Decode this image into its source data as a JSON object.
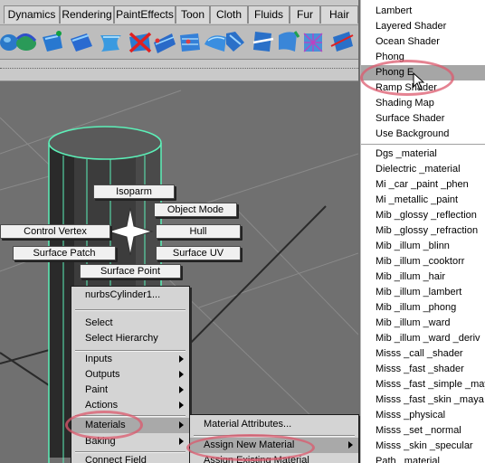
{
  "shelf_tabs": [
    "Dynamics",
    "Rendering",
    "PaintEffects",
    "Toon",
    "Cloth",
    "Fluids",
    "Fur",
    "Hair"
  ],
  "shelf_icons": [
    "sphere-shape-icon",
    "curve-tool-icon",
    "surface-icon",
    "surface-icon",
    "surface-icon",
    "delete-surface-icon",
    "surface-icon",
    "surface-icon",
    "surface-icon",
    "surface-icon",
    "surface-icon",
    "surface-icon",
    "surface-icon",
    "surface-icon"
  ],
  "marking_menu": {
    "isoparm": "Isoparm",
    "object_mode": "Object Mode",
    "control_vertex": "Control Vertex",
    "hull": "Hull",
    "surface_patch": "Surface Patch",
    "surface_uv": "Surface UV",
    "surface_point": "Surface Point"
  },
  "context_menu": {
    "object_name": "nurbsCylinder1...",
    "select": "Select",
    "select_hierarchy": "Select Hierarchy",
    "inputs": "Inputs",
    "outputs": "Outputs",
    "paint": "Paint",
    "actions": "Actions",
    "materials": "Materials",
    "baking": "Baking",
    "connect_field": "Connect Field"
  },
  "materials_submenu": {
    "material_attributes": "Material Attributes...",
    "assign_new_material": "Assign New Material",
    "assign_existing_material": "Assign Existing Material"
  },
  "shader_list_top": [
    "Lambert",
    "Layered Shader",
    "Ocean Shader",
    "Phong",
    "Phong E",
    "Ramp Shader",
    "Shading Map",
    "Surface Shader",
    "Use Background"
  ],
  "shader_list_selected": "Phong E",
  "shader_list_bottom": [
    "Dgs _material",
    "Dielectric _material",
    "Mi _car _paint _phen",
    "Mi _metallic _paint",
    "Mib _glossy _reflection",
    "Mib _glossy _refraction",
    "Mib _illum _blinn",
    "Mib _illum _cooktorr",
    "Mib _illum _hair",
    "Mib _illum _lambert",
    "Mib _illum _phong",
    "Mib _illum _ward",
    "Mib _illum _ward _deriv",
    "Misss _call _shader",
    "Misss _fast _shader",
    "Misss _fast _simple _maya",
    "Misss _fast _skin _maya",
    "Misss _physical",
    "Misss _set _normal",
    "Misss _skin _specular",
    "Path _material"
  ],
  "colors": {
    "highlight_ellipse": "#dc5a6e",
    "wireframe": "#5cf0b8",
    "menu_bg": "#d4d4d4"
  }
}
